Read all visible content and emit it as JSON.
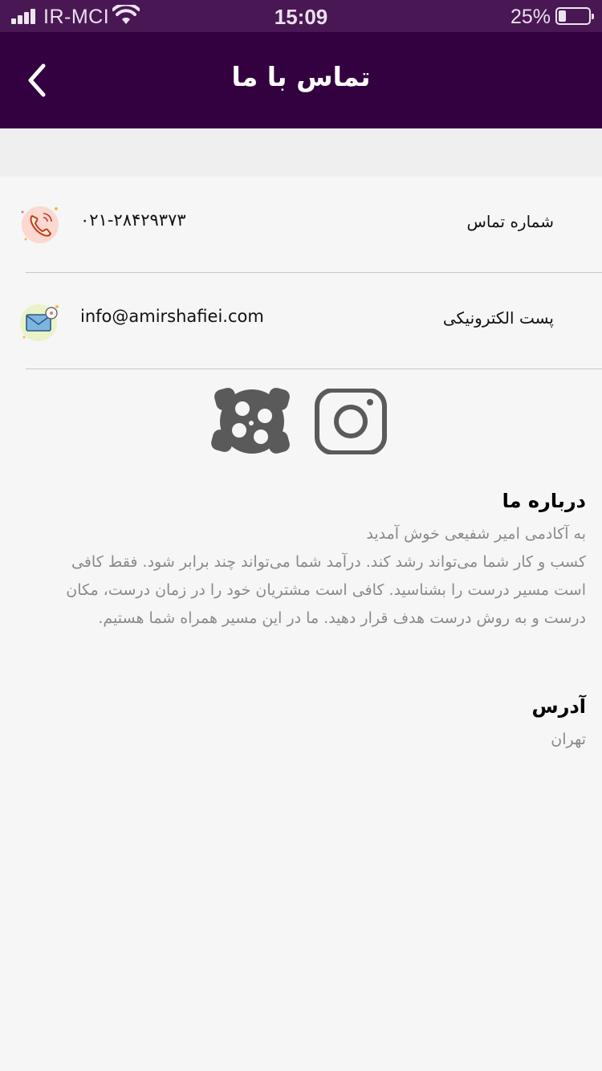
{
  "status_bar": {
    "carrier": "IR-MCI",
    "time": "15:09",
    "battery_percent": "25%",
    "battery_level": 0.25
  },
  "nav": {
    "title": "تماس با ما",
    "back_icon": "chevron-left-icon"
  },
  "contacts": [
    {
      "label": "شماره تماس",
      "value": "۰۲۱-۲۸۴۲۹۳۷۳",
      "icon": "phone-icon"
    },
    {
      "label": "پست الکترونیکی",
      "value": "info@amirshafiei.com",
      "icon": "mail-icon"
    }
  ],
  "social": {
    "aparat_icon": "aparat-icon",
    "instagram_icon": "instagram-icon"
  },
  "about": {
    "title": "درباره ما",
    "lines": [
      "به آکادمی امیر شفیعی خوش آمدید",
      "کسب و کار شما می‌تواند رشد کند. درآمد شما می‌تواند چند برابر شود. فقط کافی",
      "است مسیر درست را بشناسید. کافی است مشتریان خود را در زمان درست، مکان",
      "درست و به روش درست هدف قرار دهید. ما در این مسیر همراه شما هستیم."
    ]
  },
  "address": {
    "title": "آدرس",
    "value": "تهران"
  },
  "colors": {
    "status_bar": "#4a1755",
    "nav_bar": "#330040",
    "background": "#f6f6f6",
    "muted_text": "#8a8a8a",
    "icon_gray": "#555555"
  }
}
